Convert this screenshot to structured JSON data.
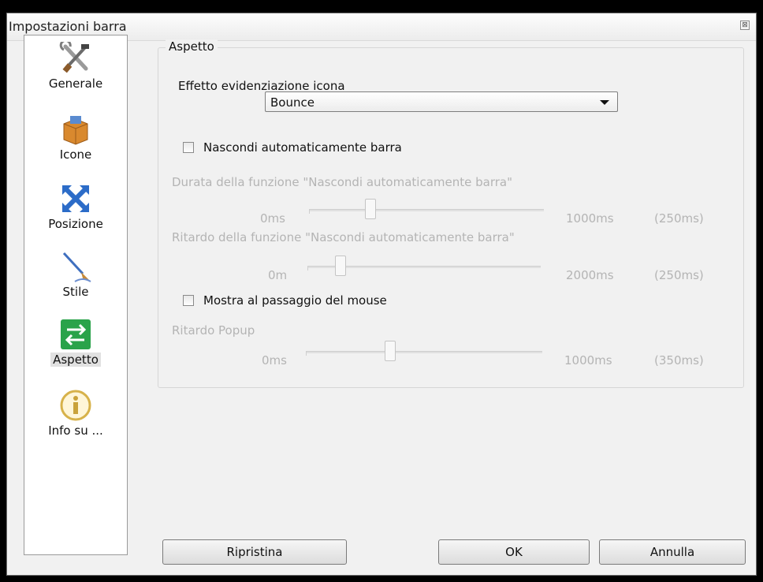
{
  "window": {
    "title": "Impostazioni barra",
    "close_glyph": "⊠"
  },
  "sidebar": {
    "items": [
      {
        "label": "Generale",
        "icon": "tools-icon",
        "selected": false
      },
      {
        "label": "Icone",
        "icon": "box-icon",
        "selected": false
      },
      {
        "label": "Posizione",
        "icon": "move-arrows-icon",
        "selected": false
      },
      {
        "label": "Stile",
        "icon": "brush-icon",
        "selected": false
      },
      {
        "label": "Aspetto",
        "icon": "swap-arrows-icon",
        "selected": true
      },
      {
        "label": "Info su ...",
        "icon": "info-icon",
        "selected": false
      }
    ]
  },
  "aspect": {
    "group_title": "Aspetto",
    "highlight_effect_label": "Effetto evidenziazione icona",
    "highlight_effect_value": "Bounce",
    "autohide_label": "Nascondi automaticamente barra",
    "autohide_checked": false,
    "autohide_duration": {
      "label": "Durata della funzione \"Nascondi automaticamente barra\"",
      "min_label": "0ms",
      "max_label": "1000ms",
      "value_label": "(250ms)",
      "fraction": 0.25
    },
    "autohide_delay": {
      "label": "Ritardo della funzione \"Nascondi automaticamente barra\"",
      "min_label": "0m",
      "max_label": "2000ms",
      "value_label": "(250ms)",
      "fraction": 0.125
    },
    "mouseover_label": "Mostra al passaggio del mouse",
    "mouseover_checked": false,
    "popup_delay": {
      "label": "Ritardo Popup",
      "min_label": "0ms",
      "max_label": "1000ms",
      "value_label": "(350ms)",
      "fraction": 0.35
    }
  },
  "buttons": {
    "reset": "Ripristina",
    "ok": "OK",
    "cancel": "Annulla"
  },
  "colors": {
    "disabled_text": "#b4b4b4",
    "window_bg": "#f1f1f1",
    "sidebar_bg": "#ffffff"
  }
}
